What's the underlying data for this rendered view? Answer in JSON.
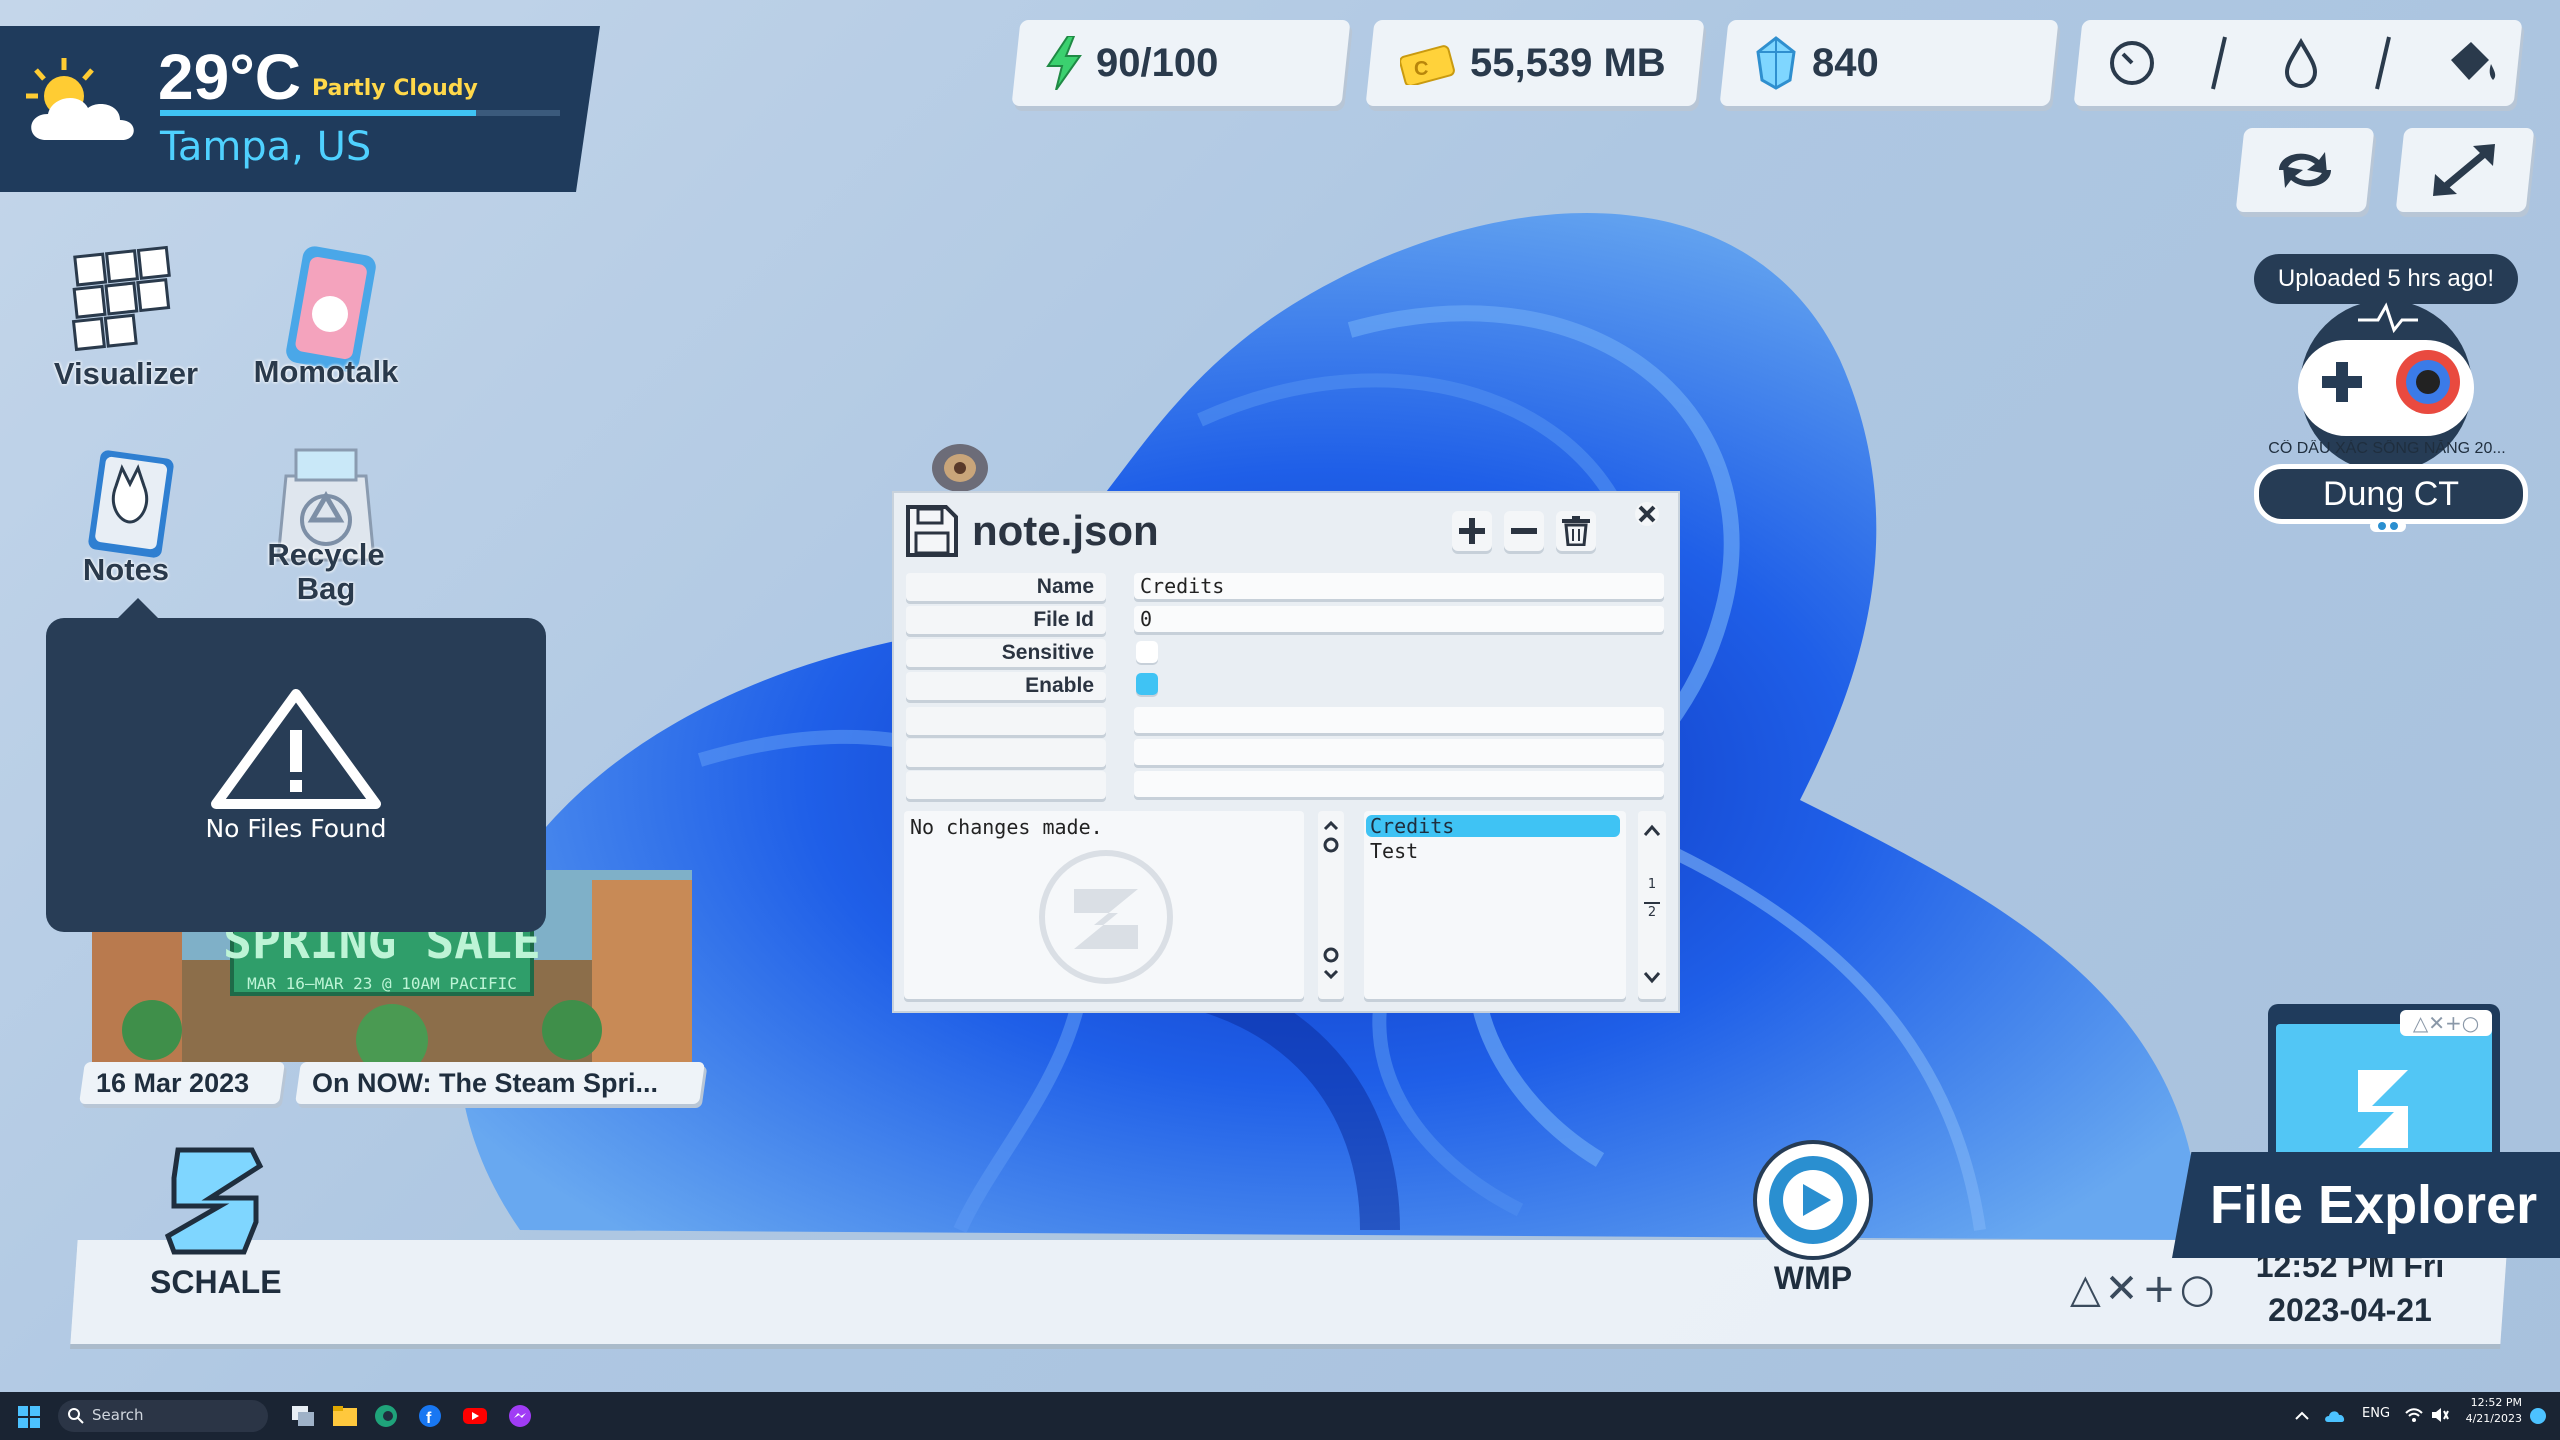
{
  "weather": {
    "temperature": "29°C",
    "condition": "Partly Cloudy",
    "location": "Tampa, US"
  },
  "stats": {
    "energy": "90/100",
    "storage": "55,539 MB",
    "gems": "840"
  },
  "top_controls": [
    "speed-icon",
    "water-drop-icon",
    "paint-bucket-icon",
    "refresh-icon",
    "fullscreen-icon"
  ],
  "desktop_icons": {
    "visualizer": "Visualizer",
    "momotalk": "Momotalk",
    "notes": "Notes",
    "recycle": "Recycle Bag"
  },
  "popup": {
    "message": "No Files Found"
  },
  "steam": {
    "banner_title": "SPRING SALE",
    "banner_sub": "MAR 16–MAR 23 @ 10AM PACIFIC",
    "date": "16 Mar 2023",
    "headline": "On NOW: The Steam Spri..."
  },
  "profile": {
    "upload_status": "Uploaded 5 hrs ago!",
    "track": "CÔ DÂU XÁC SỐNG NĂNG 20...",
    "user": "Dung CT"
  },
  "dialog": {
    "title": "note.json",
    "fields": {
      "name_label": "Name",
      "name_value": "Credits",
      "fileid_label": "File Id",
      "fileid_value": "0",
      "sensitive_label": "Sensitive",
      "enable_label": "Enable"
    },
    "log": "No changes made.",
    "list": [
      "Credits",
      "Test"
    ],
    "pages": [
      "1",
      "2"
    ],
    "sensitive_checked": false,
    "enable_checked": true
  },
  "dock": {
    "schale": "SCHALE",
    "wmp": "WMP",
    "symbols": "△✕+○",
    "time": "12:52 PM Fri",
    "date": "2023-04-21"
  },
  "file_explorer": {
    "label": "File Explorer",
    "tag": "△✕+○"
  },
  "win_taskbar": {
    "search": "Search",
    "lang": "ENG",
    "time": "12:52 PM",
    "date": "4/21/2023"
  },
  "colors": {
    "accent": "#3fc3f4",
    "dark_panel": "#1f3b5c",
    "dialog_bg": "#e9eef3"
  }
}
